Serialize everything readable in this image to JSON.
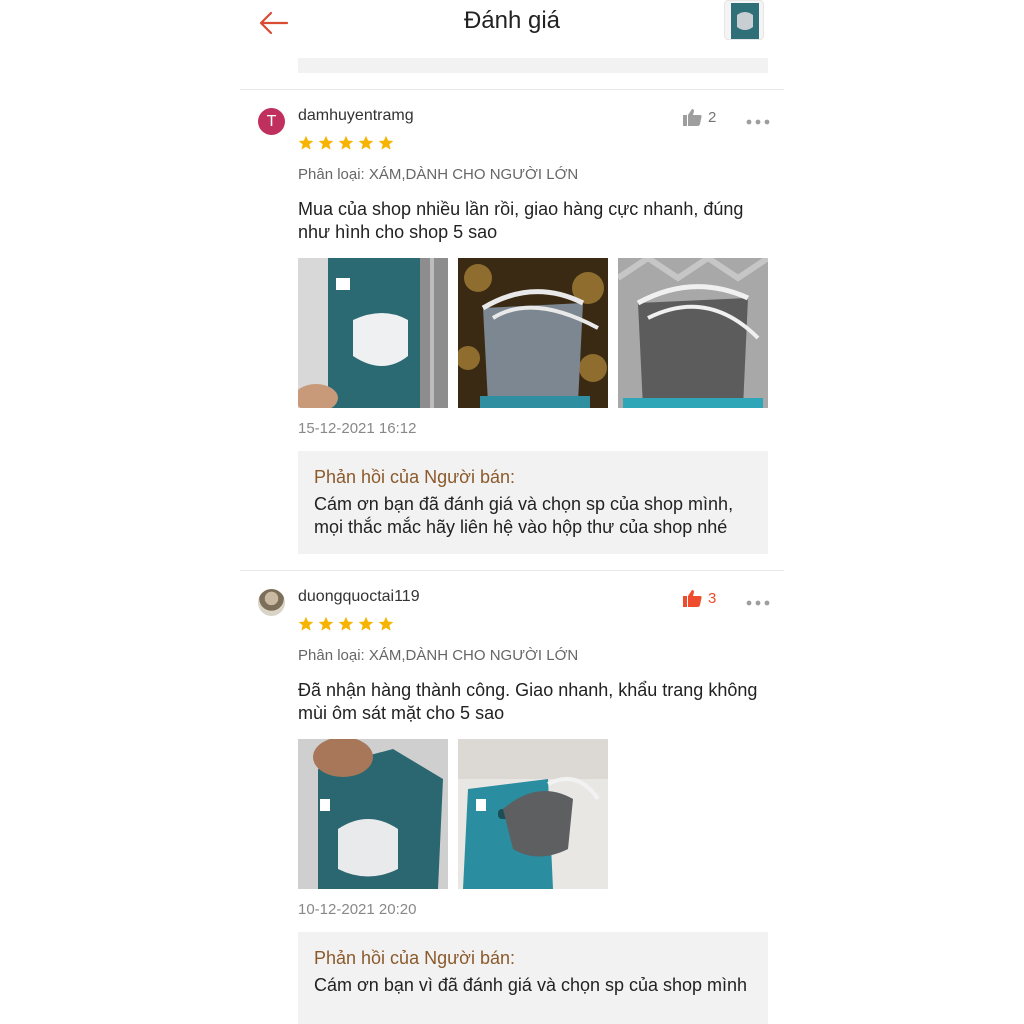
{
  "header": {
    "title": "Đánh giá",
    "back_icon": "arrow-left-icon",
    "accent": "#d0011b"
  },
  "reviews": [
    {
      "username": "damhuyentramg",
      "avatar_letter": "T",
      "rating": 5,
      "likes": "2",
      "liked": false,
      "variant": "Phân loại: XÁM,DÀNH CHO NGƯỜI LỚN",
      "comment": "Mua của shop nhiều lần rồi, giao hàng cực nhanh, đúng như hình cho shop 5 sao",
      "date": "15-12-2021 16:12",
      "reply_title": "Phản hồi của Người bán:",
      "reply_text": "Cám ơn bạn đã đánh giá và chọn sp của shop mình, mọi thắc mắc hãy liên hệ vào hộp thư của shop nhé"
    },
    {
      "username": "duongquoctai119",
      "rating": 5,
      "likes": "3",
      "liked": true,
      "variant": "Phân loại: XÁM,DÀNH CHO NGƯỜI LỚN",
      "comment": "Đã nhận hàng thành công. Giao nhanh, khẩu trang không mùi ôm sát mặt cho 5 sao",
      "date": "10-12-2021 20:20",
      "reply_title": "Phản hồi của Người bán:",
      "reply_text": "Cám ơn bạn vì đã đánh giá và chọn sp của shop mình"
    }
  ],
  "colors": {
    "star": "#f6b400",
    "like_active": "#ee4d2d",
    "like_inactive": "#9e9e9e",
    "reply_title": "#8b5a2b"
  }
}
